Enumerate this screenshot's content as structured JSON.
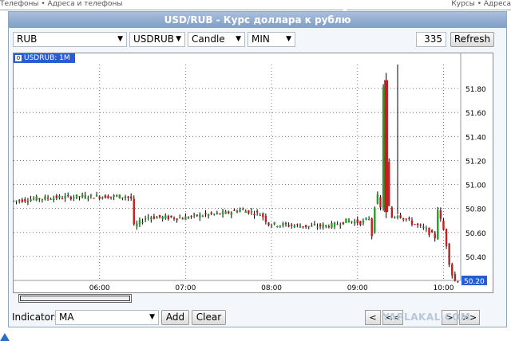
{
  "title": "USD/RUB - Курс доллара к рублю",
  "top_left_text": "Телефоны • Адреса и телефоны",
  "top_right_text": "Курсы • Адреса",
  "controls": {
    "currency": "RUB",
    "symbol": "USDRUB",
    "chart_type": "Candle",
    "interval": "MIN",
    "count": "335",
    "refresh_label": "Refresh"
  },
  "chart_tab_label": "USDRUB: 1M",
  "indicators": {
    "label": "Indicators",
    "value": "MA",
    "add_label": "Add",
    "clear_label": "Clear"
  },
  "nav": [
    "<",
    "<<",
    ">",
    ">>"
  ],
  "watermark": "YAPLAKAL.COM",
  "chart_data": {
    "type": "candlestick",
    "x_ticks": [
      "06:00",
      "07:00",
      "08:00",
      "09:00",
      "10:00"
    ],
    "y_ticks": [
      "50.40",
      "50.60",
      "50.80",
      "51.00",
      "51.20",
      "51.40",
      "51.60",
      "51.80"
    ],
    "ylim": [
      50.2,
      52.0
    ],
    "last_price": "50.20",
    "colors": {
      "up": "#2a9a2a",
      "down": "#c02020",
      "wick": "#000000",
      "last_bg": "#2a5bd7"
    },
    "series_path": [
      [
        "05:00",
        50.86
      ],
      [
        "05:15",
        50.88
      ],
      [
        "05:30",
        50.89
      ],
      [
        "05:50",
        50.9
      ],
      [
        "06:20",
        50.9
      ],
      [
        "06:25",
        50.88
      ],
      [
        "06:26",
        50.65
      ],
      [
        "06:35",
        50.73
      ],
      [
        "07:00",
        50.72
      ],
      [
        "07:10",
        50.74
      ],
      [
        "07:30",
        50.76
      ],
      [
        "07:40",
        50.79
      ],
      [
        "07:55",
        50.75
      ],
      [
        "08:00",
        50.67
      ],
      [
        "08:30",
        50.65
      ],
      [
        "08:45",
        50.66
      ],
      [
        "08:50",
        50.68
      ],
      [
        "08:55",
        50.7
      ],
      [
        "09:05",
        50.68
      ],
      [
        "09:10",
        50.72
      ],
      [
        "09:12",
        50.58
      ],
      [
        "09:15",
        50.95
      ],
      [
        "09:18",
        50.8
      ],
      [
        "09:20",
        51.82
      ],
      [
        "09:23",
        50.9
      ],
      [
        "09:25",
        50.72
      ],
      [
        "09:30",
        50.75
      ],
      [
        "09:40",
        50.68
      ],
      [
        "09:50",
        50.62
      ],
      [
        "09:57",
        50.55
      ],
      [
        "09:58",
        50.8
      ],
      [
        "10:00",
        50.7
      ],
      [
        "10:02",
        50.62
      ],
      [
        "10:04",
        50.5
      ],
      [
        "10:06",
        50.35
      ],
      [
        "10:08",
        50.25
      ],
      [
        "10:10",
        50.2
      ]
    ],
    "spike": {
      "time": "09:20",
      "low": 50.72,
      "high": 51.93
    },
    "spike_wick": {
      "time": "09:28",
      "low": 50.75,
      "high": 52.0
    }
  }
}
